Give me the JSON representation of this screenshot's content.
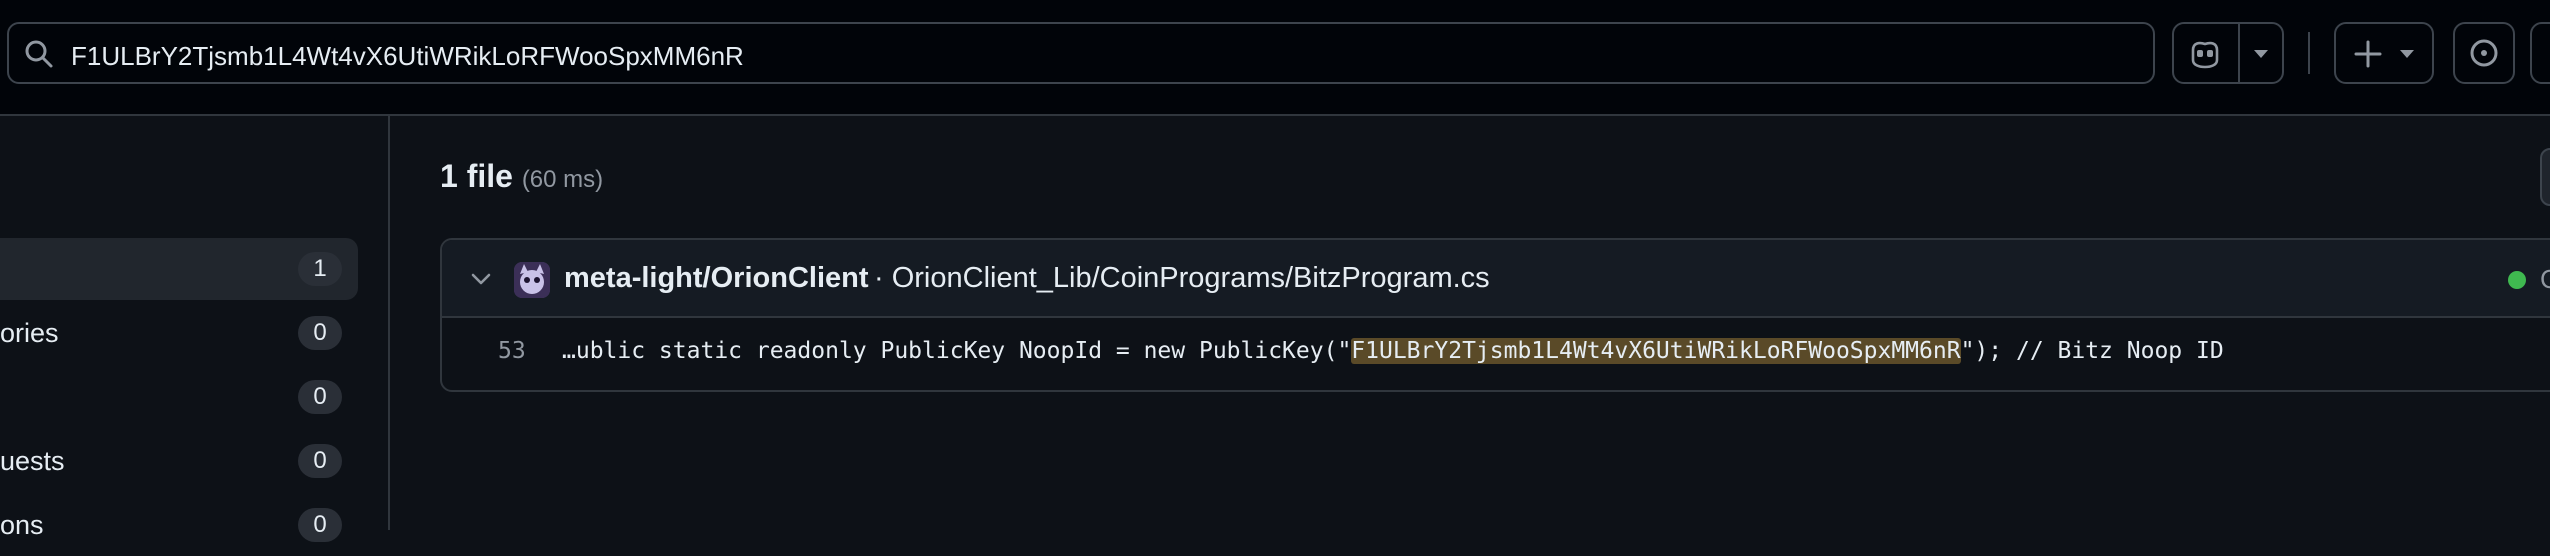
{
  "search": {
    "query": "F1ULBrY2Tjsmb1L4Wt4vX6UtiWRikLoRFWooSpxMM6nR"
  },
  "header_icons": {
    "search": "search-icon",
    "copilot": "copilot-icon",
    "dropdown": "triangle-down-icon",
    "plus": "plus-icon",
    "issues": "issue-opened-icon"
  },
  "sidebar": {
    "items": [
      {
        "label": "",
        "count": "1"
      },
      {
        "label": "ories",
        "count": "0"
      },
      {
        "label": "",
        "count": "0"
      },
      {
        "label": "uests",
        "count": "0"
      },
      {
        "label": "ons",
        "count": "0"
      }
    ]
  },
  "results": {
    "count_label": "1 file",
    "time_label": "(60 ms)"
  },
  "result_card": {
    "repo": "meta-light/OrionClient",
    "separator": " · ",
    "path": "OrionClient_Lib/CoinPrograms/BitzProgram.cs",
    "status_text": "C",
    "line_number": "53",
    "code_before": "…ublic static readonly PublicKey NoopId = new PublicKey(\"",
    "code_match": "F1ULBrY2Tjsmb1L4Wt4vX6UtiWRikLoRFWooSpxMM6nR",
    "code_after": "\"); // Bitz Noop ID"
  },
  "colors": {
    "background": "#0d1117",
    "header_bg": "#010409",
    "match_highlight": "#5a4a28",
    "status_green": "#3fb950"
  }
}
